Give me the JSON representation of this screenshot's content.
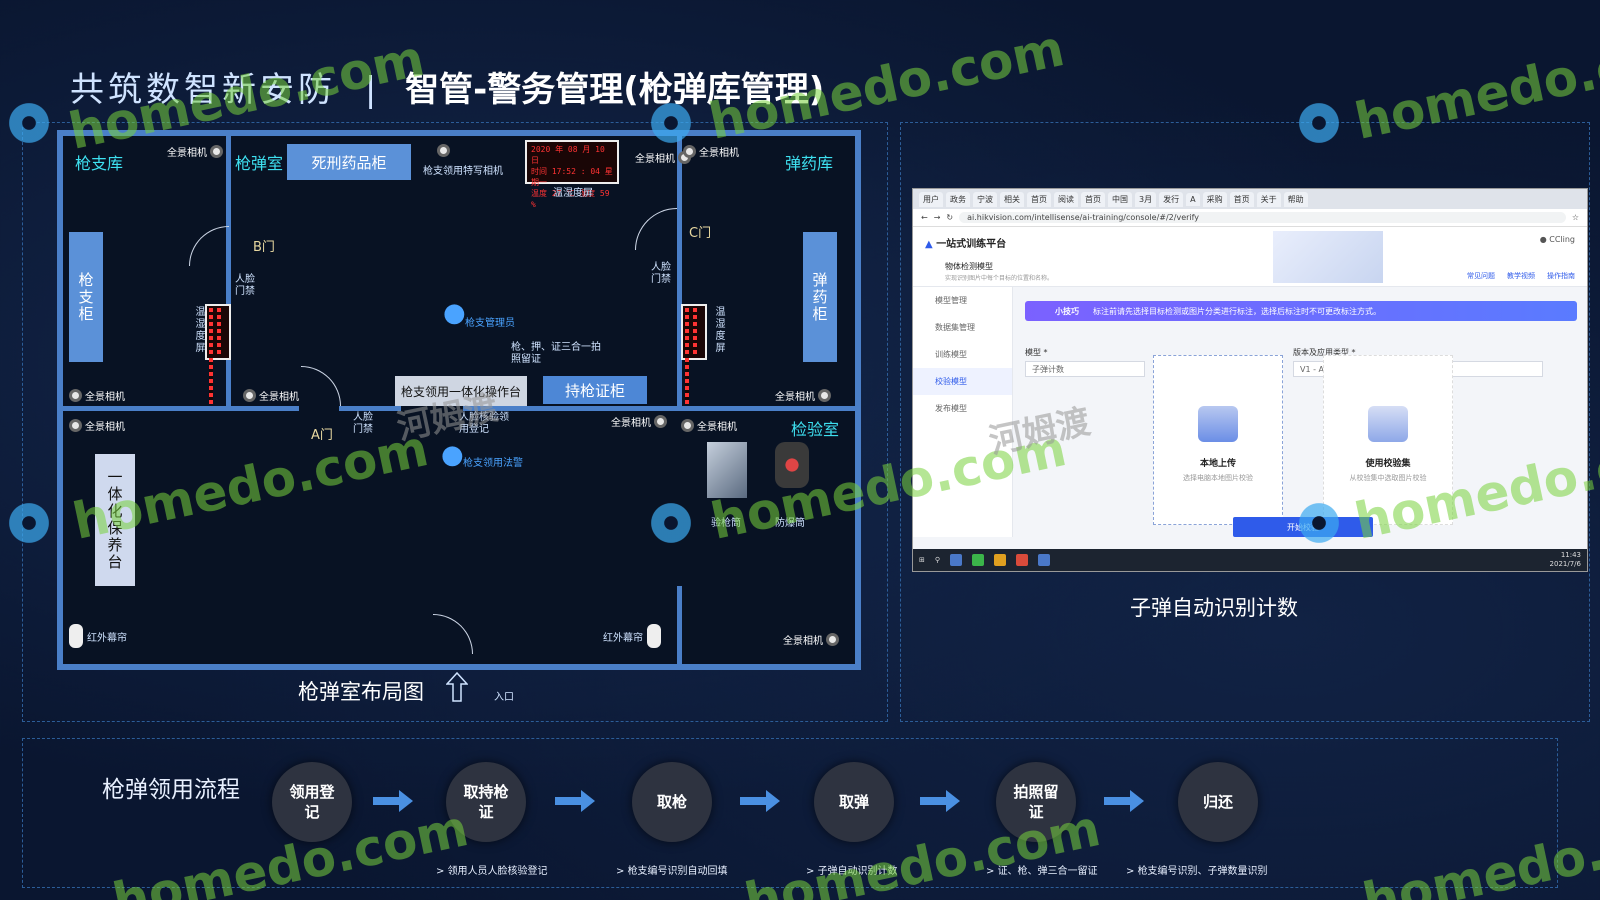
{
  "title": {
    "left": "共筑数智新安防",
    "separator": "|",
    "right": "智管-警务管理(枪弹库管理)"
  },
  "plan": {
    "caption": "枪弹室布局图",
    "entrance": "入口",
    "rooms": {
      "gun_store": "枪支库",
      "gun_room": "枪弹室",
      "ammo_store": "弹药库",
      "inspection": "检验室"
    },
    "cabinets": {
      "gun_cabinet": "枪支柜",
      "ammo_cabinet": "弹药柜",
      "drug_cabinet": "死刑药品柜",
      "operator_desk": "枪支领用一体化操作台",
      "license_cabinet": "持枪证柜",
      "safe_desk": "一体化保养台"
    },
    "labels": {
      "panorama_camera": "全景相机",
      "special_camera": "枪支领用特写相机",
      "temp_humidity_screen": "温湿度屏",
      "temp_screen_v": "温湿度屏",
      "face_access": "人脸门禁",
      "door_a": "A门",
      "door_b": "B门",
      "door_c": "C门",
      "gun_admin": "枪支管理员",
      "three_in_one": "枪、押、证三合一拍照留证",
      "face_register": "人脸核验领用登记",
      "gun_police": "枪支领用法警",
      "ir_curtain": "红外幕帘",
      "gun_checker": "验枪筒",
      "explosion_tank": "防爆筒"
    },
    "led": {
      "line1": "2020 年 08 月 10 日",
      "line2": "时间 17:52 : 04 星期一",
      "line3": "温度 27 ℃  湿度 59 %"
    }
  },
  "screenshot": {
    "caption": "子弹自动识别计数",
    "tabs": [
      "用户",
      "政务",
      "宁波",
      "相关",
      "首页",
      "阅读",
      "首页",
      "中国",
      "3月",
      "发行",
      "A",
      "采购",
      "首页",
      "关于",
      "帮助"
    ],
    "url": "ai.hikvision.com/intellisense/ai-training/console/#/2/verify",
    "app_title": "一站式训练平台",
    "module_title": "物体检测模型",
    "module_sub": "实现识别图片中每个目标的位置和名称。",
    "header_links": [
      "常见问题",
      "教学视频",
      "操作指南"
    ],
    "user": "CCling",
    "sidebar": [
      "模型管理",
      "数据集管理",
      "训练模型",
      "校验模型",
      "发布模型"
    ],
    "tip_label": "小技巧",
    "tip_text": "标注前请先选择目标检测或图片分类进行标注，选择后标注时不可更改标注方式。",
    "model_label": "模型 *",
    "model_value": "子弹计数",
    "version_label": "版本及应用类型 *",
    "version_value": "V1 - AI云服务/云服务",
    "upload_title": "本地上传",
    "upload_sub": "选择电脑本地图片校验",
    "dataset_title": "使用校验集",
    "dataset_sub": "从校验集中选取图片校验",
    "start_btn": "开始校验",
    "clock": "11:43",
    "date": "2021/7/6"
  },
  "flow": {
    "title": "枪弹领用流程",
    "steps": [
      "领用登记",
      "取持枪证",
      "取枪",
      "取弹",
      "拍照留证",
      "归还"
    ],
    "notes": [
      "领用人员人脸核验登记",
      "枪支编号识别自动回填",
      "子弹自动识别计数",
      "证、枪、弹三合一留证",
      "枪支编号识别、子弹数量识别"
    ]
  },
  "watermarks": {
    "en": "homedo.com",
    "cn": "河姆渡"
  },
  "colors": {
    "accent": "#4a7fc8",
    "room_label": "#3ee0f0",
    "step_bg": "#2e3340",
    "arrow": "#4a90e2"
  }
}
